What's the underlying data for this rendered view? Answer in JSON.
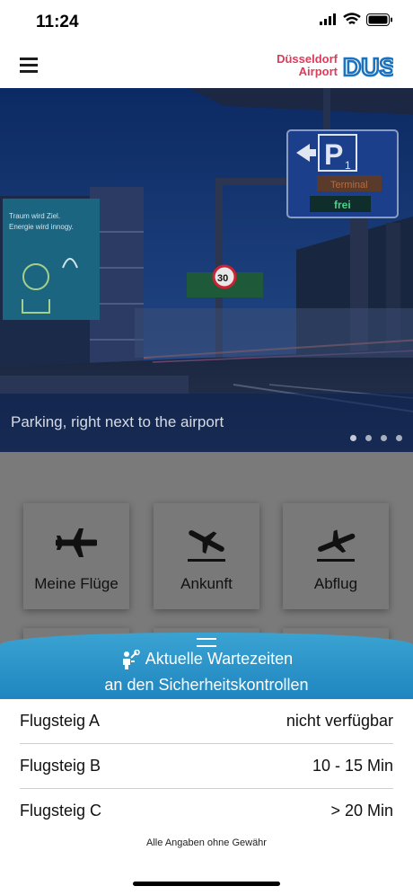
{
  "status_bar": {
    "time": "11:24"
  },
  "header": {
    "logo_line1": "Düsseldorf",
    "logo_line2": "Airport",
    "logo_mark": "DUS",
    "brand_colors": {
      "red": "#e03a5a",
      "blue": "#1a73c0"
    }
  },
  "hero": {
    "caption": "Parking, right next to the airport",
    "slide_count": 4,
    "active_slide": 1,
    "sign_letter": "P",
    "sign_subscript": "1",
    "sign_label_terminal": "Terminal",
    "sign_label_free": "frei",
    "speed_limit": "30",
    "billboard_text": "Traum wird Ziel. Energie wird innogy."
  },
  "tiles": [
    {
      "label": "Meine Flüge",
      "icon": "airplane-icon"
    },
    {
      "label": "Ankunft",
      "icon": "arrival-icon"
    },
    {
      "label": "Abflug",
      "icon": "departure-icon"
    }
  ],
  "wait_times": {
    "title_line1": "Aktuelle Wartezeiten",
    "title_line2": "an den Sicherheitskontrollen",
    "icon": "security-check-icon",
    "rows": [
      {
        "gate": "Flugsteig A",
        "time": "nicht verfügbar"
      },
      {
        "gate": "Flugsteig B",
        "time": "10 - 15 Min"
      },
      {
        "gate": "Flugsteig C",
        "time": "> 20 Min"
      }
    ],
    "disclaimer": "Alle Angaben ohne Gewähr"
  }
}
